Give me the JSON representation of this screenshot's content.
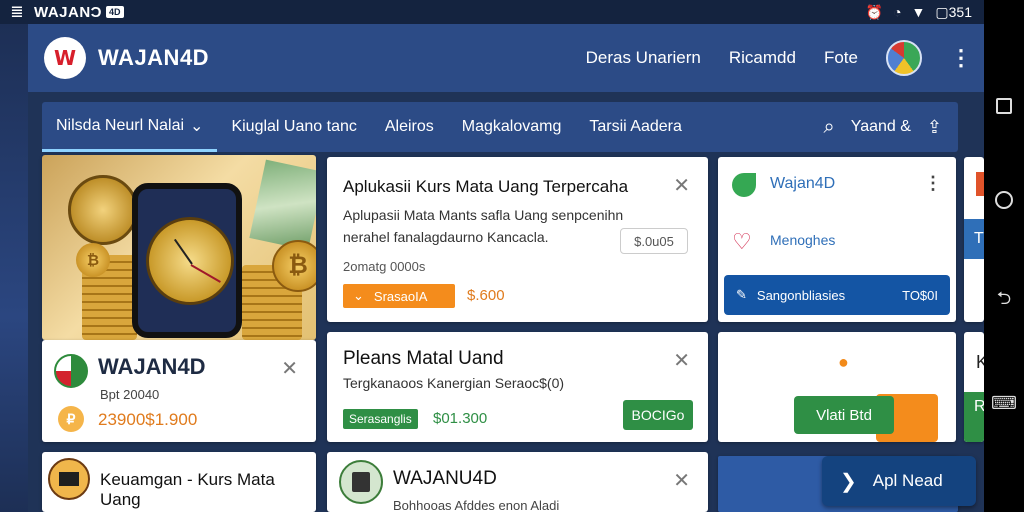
{
  "status_bar": {
    "title": "WAJANƆ",
    "badge": "4D",
    "right_text": "▢351",
    "icons": [
      "alarm-icon",
      "signal-icon",
      "wifi-icon",
      "battery-icon"
    ]
  },
  "header": {
    "brand": "WAJAN4D",
    "nav": [
      "Deras Unariern",
      "Ricamdd",
      "Fote"
    ],
    "colors": {
      "header_bg": "#2c4b86",
      "accent_orange": "#f48c1c",
      "accent_green": "#2f8f45",
      "accent_blue": "#1455a4"
    }
  },
  "tabs": {
    "items": [
      "Nilsda Neurl Nalai",
      "Kiuglal Uano tanc",
      "Aleiros",
      "Magkalovamg",
      "Tarsii Aadera"
    ],
    "active_chevron": "⌄",
    "account_label": "Yaand &"
  },
  "hero": {
    "coin_symbol": "₿"
  },
  "app_card": {
    "name": "WAJAN4D",
    "date": "Bpt 20040",
    "coin_symbol": "₽",
    "price": "23900$1.900"
  },
  "offer_card": {
    "title": "Aplukasii Kurs Mata Uang Terpercaha",
    "description": "Aplupasii Mata Mants safla Uang senpcenihn nerahel fanalagdaurno Kancacla.",
    "pill": "$.0u05",
    "date": "2omatg 0000s",
    "button_label": "SrasaoIA",
    "button_icon": "⌄",
    "price": "$.600"
  },
  "currency_card": {
    "title": "Pleans Matal Uand",
    "description": "Tergkanaoos Kanergian Seraoc$(0)",
    "badge": "Serasanglis",
    "price": "$01.300",
    "button_label": "BOCIGo"
  },
  "side_card": {
    "app_name": "Wajan4D",
    "message": "Menoghes",
    "action_label": "Sangonbliasies",
    "action_amount": "TO$0I",
    "action_icon": "✎"
  },
  "side_card_2": {
    "button_label": "Vlati Btd"
  },
  "edge_cards": {
    "top_letter": "T",
    "mid_letter": "K",
    "bottom_letter": "R"
  },
  "bottom_cards": {
    "left_label": "Keuamgan - Kurs Mata Uang",
    "mid_title": "WAJANU4D",
    "mid_desc": "Bohhooas Afddes enon Aladi"
  },
  "floating_button": {
    "label": "Apl Nead",
    "icon": "❯"
  }
}
